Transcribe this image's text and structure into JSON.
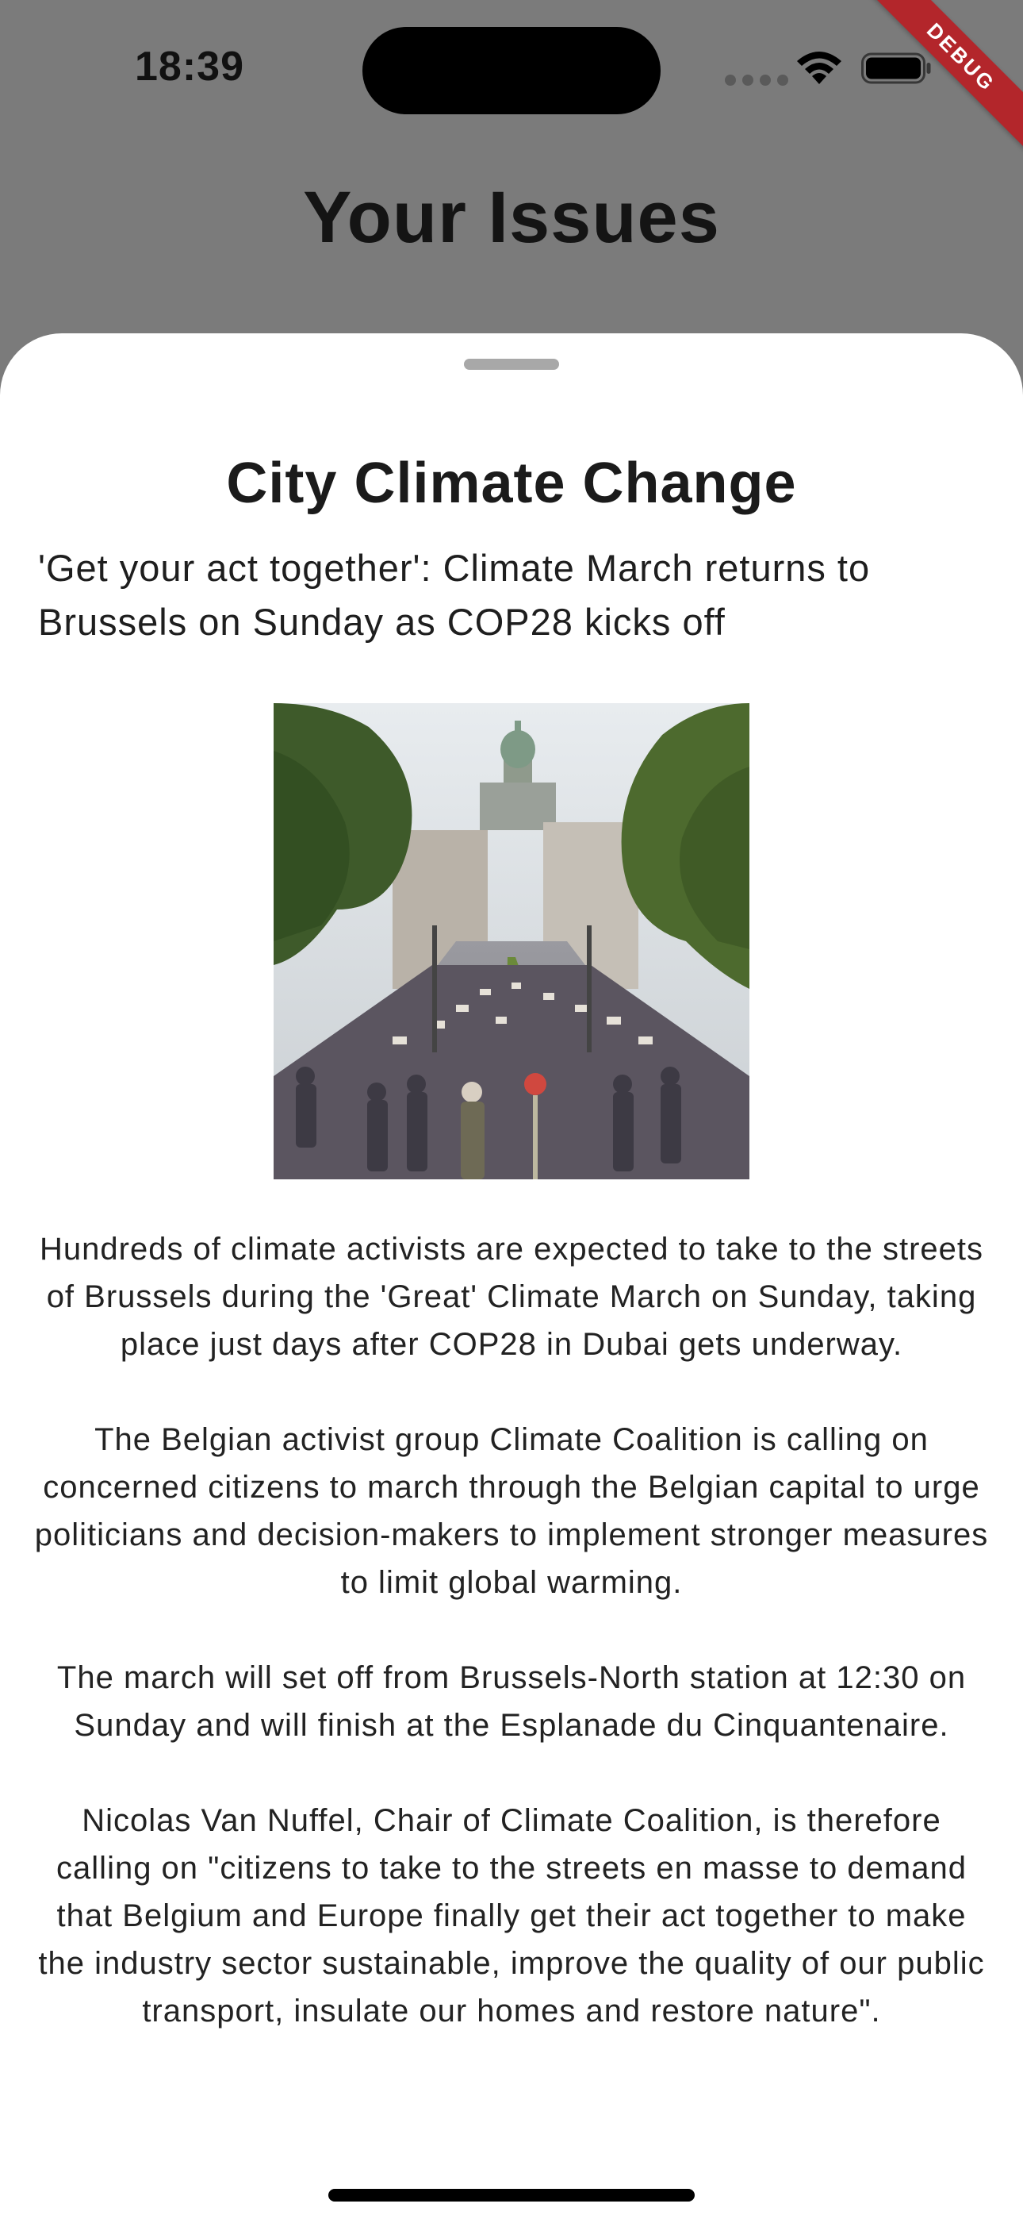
{
  "status_bar": {
    "time": "18:39",
    "icons": [
      "cellular-dots-icon",
      "wifi-icon",
      "battery-icon"
    ]
  },
  "debug_banner": "DEBUG",
  "page": {
    "title": "Your Issues"
  },
  "sheet": {
    "title": "City Climate Change",
    "headline": "'Get your act together': Climate March returns to Brussels on Sunday as COP28 kicks off",
    "image_alt": "Climate march crowd on a tree-lined boulevard in Brussels",
    "paragraphs": [
      "Hundreds of climate activists are expected to take to the streets of Brussels during the 'Great' Climate March on Sunday, taking place just days after COP28 in Dubai gets underway.",
      "The Belgian activist group Climate Coalition is calling on concerned citizens to march through the Belgian capital to urge politicians and decision-makers to implement stronger measures to limit global warming.",
      "The march will set off from Brussels-North station at 12:30 on Sunday and will finish at the Esplanade du Cinquantenaire.",
      "Nicolas Van Nuffel, Chair of Climate Coalition, is therefore calling on \"citizens to take to the streets en masse to demand that Belgium and Europe finally get their act together to make the industry sector sustainable, improve the quality of our public transport, insulate our homes and restore nature\"."
    ]
  },
  "colors": {
    "scrim": "#7b7b7b",
    "sheet_bg": "#ffffff",
    "debug_ribbon": "#b3262b",
    "text": "#1e1e1e"
  }
}
